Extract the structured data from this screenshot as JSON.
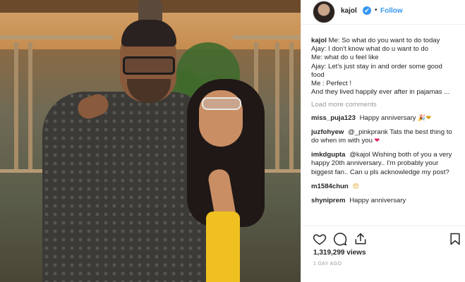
{
  "post": {
    "username": "kajol",
    "follow_label": "Follow",
    "separator": "•",
    "verified_symbol": "✔"
  },
  "caption": {
    "user": "kajol",
    "lines": [
      "Me: So what do you want to do today",
      "Ajay: I don't know what do u want to do",
      "Me: what do u feel like",
      "Ajay: Let's just stay in and order some good food",
      "Me : Perfect !",
      "And they lived happily ever after in pajamas ..."
    ]
  },
  "load_more": "Load more comments",
  "comments": [
    {
      "user": "miss_puja123",
      "text": "Happy anniversary",
      "emoji": "🎉❤"
    },
    {
      "user": "juzfohyew",
      "text": "@_pinkprank Tats the best thing to do when im with you",
      "emoji": "❤"
    },
    {
      "user": "imkdgupta",
      "text": "@kajol Wishing both of you a very happy 20th anniversary.. I'm probably your biggest fan.. Can u pls acknowledge my post?",
      "emoji": ""
    },
    {
      "user": "m1584chun",
      "text": "",
      "emoji": "😍"
    },
    {
      "user": "shyniprem",
      "text": "Happy anniversary",
      "emoji": ""
    }
  ],
  "stats": {
    "views": "1,319,299 views",
    "timestamp": "1 DAY AGO"
  },
  "icons": {
    "like": "heart-icon",
    "comment": "comment-icon",
    "share": "share-icon",
    "save": "bookmark-icon"
  },
  "colors": {
    "link": "#3897f0",
    "verified": "#3897f0",
    "muted": "#999999",
    "text": "#262626"
  }
}
